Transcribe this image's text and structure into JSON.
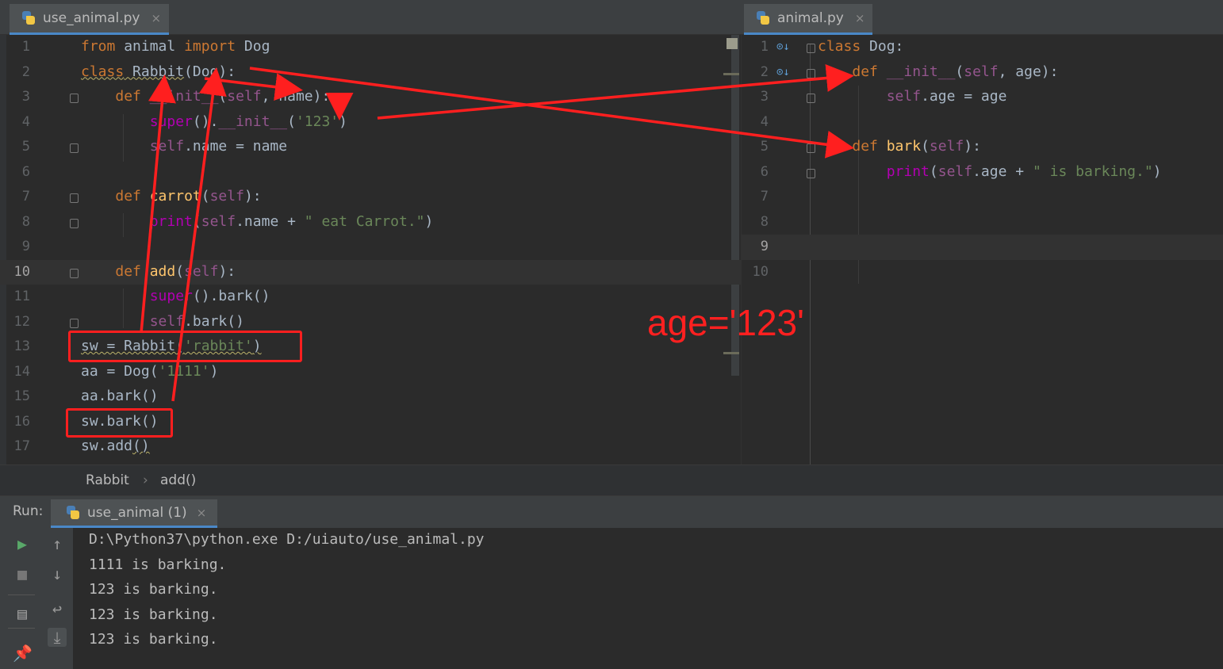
{
  "left_tab": {
    "name": "use_animal.py",
    "close": "×"
  },
  "right_tab": {
    "name": "animal.py",
    "close": "×"
  },
  "left_editor": {
    "line_numbers": [
      "1",
      "2",
      "3",
      "4",
      "5",
      "6",
      "7",
      "8",
      "9",
      "10",
      "11",
      "12",
      "13",
      "14",
      "15",
      "16",
      "17"
    ],
    "current_line": "10"
  },
  "right_editor": {
    "line_numbers": [
      "1",
      "2",
      "3",
      "4",
      "5",
      "6",
      "7",
      "8",
      "9",
      "10"
    ],
    "current_line": "9"
  },
  "breadcrumb": {
    "class": "Rabbit",
    "separator": "›",
    "method": "add()"
  },
  "run": {
    "label": "Run:",
    "tab": "use_animal (1)",
    "close": "×",
    "output": [
      "D:\\Python37\\python.exe D:/uiauto/use_animal.py",
      "1111 is barking.",
      "123 is barking.",
      "123 is barking.",
      "123 is barking."
    ]
  },
  "annotation": {
    "text": "age='123'",
    "color": "#ff2020"
  },
  "colors": {
    "keyword": "#cc7832",
    "magic": "#94558d",
    "string": "#6a8759",
    "function": "#ffc66d",
    "text": "#a9b7c6",
    "accent": "#4a88c7"
  }
}
